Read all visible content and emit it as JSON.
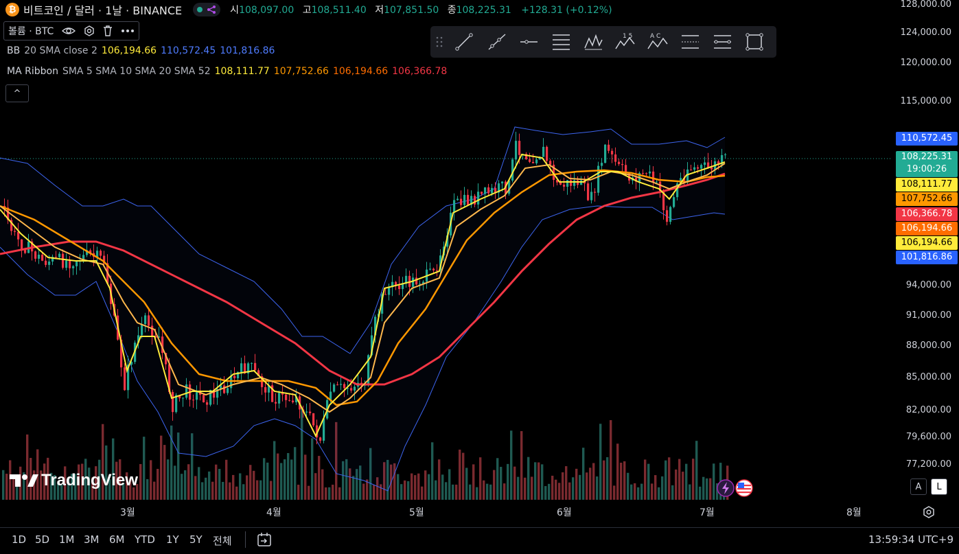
{
  "header": {
    "coin_glyph": "₿",
    "symbol": "비트코인 / 달러 · 1날 · BINANCE",
    "ohlc": {
      "open_label": "시",
      "open": "108,097.00",
      "high_label": "고",
      "high": "108,511.40",
      "low_label": "저",
      "low": "107,851.50",
      "close_label": "종",
      "close": "108,225.31",
      "change": "+128.31 (+0.12%)"
    }
  },
  "volume_box": {
    "label": "볼륨 · BTC"
  },
  "indicators": {
    "bb": {
      "name": "BB",
      "params": "20 SMA close 2",
      "basis": "106,194.66",
      "upper": "110,572.45",
      "lower": "101,816.86",
      "colors": {
        "basis": "#ffeb3b",
        "upper": "#3d65f0",
        "lower": "#3d65f0"
      }
    },
    "ribbon": {
      "name": "MA Ribbon",
      "params": "SMA 5 SMA 10 SMA 20 SMA 52",
      "v1": "108,111.77",
      "v2": "107,752.66",
      "v3": "106,194.66",
      "v4": "106,366.78",
      "colors": {
        "v1": "#ffeb3b",
        "v2": "#ff9800",
        "v3": "#ff6d00",
        "v4": "#f23645"
      }
    }
  },
  "collapse_glyph": "^",
  "toolbar": {
    "tools": [
      "drag-handle",
      "trend-line",
      "ray",
      "horizontal-ray",
      "fib-retracement",
      "pattern",
      "elliott-wave",
      "abcd-pattern",
      "parallel-channel",
      "regression-trend",
      "rectangle"
    ],
    "labels": {
      "elliott": "1 5",
      "abcd": "A C"
    }
  },
  "price_axis": {
    "ticks": [
      "128,000.00",
      "124,000.00",
      "120,000.00",
      "115,000.00",
      "94,000.00",
      "91,000.00",
      "88,000.00",
      "85,000.00",
      "82,000.00",
      "79,600.00",
      "77,200.00"
    ]
  },
  "price_labels": [
    {
      "text": "110,572.45",
      "bg": "#2962ff",
      "fg": "#ffffff"
    },
    {
      "text": "108,225.31",
      "sub": "19:00:26",
      "bg": "#22ab94",
      "fg": "#ffffff"
    },
    {
      "text": "108,111.77",
      "bg": "#ffeb3b",
      "fg": "#000000"
    },
    {
      "text": "107,752.66",
      "bg": "#ff9800",
      "fg": "#000000"
    },
    {
      "text": "106,366.78",
      "bg": "#f23645",
      "fg": "#ffffff"
    },
    {
      "text": "106,194.66",
      "bg": "#ff6d00",
      "fg": "#ffffff"
    },
    {
      "text": "106,194.66",
      "bg": "#ffeb3b",
      "fg": "#000000"
    },
    {
      "text": "101,816.86",
      "bg": "#2962ff",
      "fg": "#ffffff"
    }
  ],
  "time_axis": {
    "labels": [
      "3월",
      "4월",
      "5월",
      "6월",
      "7월",
      "8월"
    ]
  },
  "timeframes": [
    "1D",
    "5D",
    "1M",
    "3M",
    "6M",
    "YTD",
    "1Y",
    "5Y",
    "전체"
  ],
  "clock": "13:59:34 UTC+9",
  "logo_text": "TradingView",
  "scale_buttons": {
    "auto": "A",
    "log": "L"
  },
  "colors": {
    "up": "#22ab94",
    "down": "#f23645",
    "bb": "#3d65f0",
    "vol_up": "#1f5a52",
    "vol_down": "#7a2a2f"
  }
}
